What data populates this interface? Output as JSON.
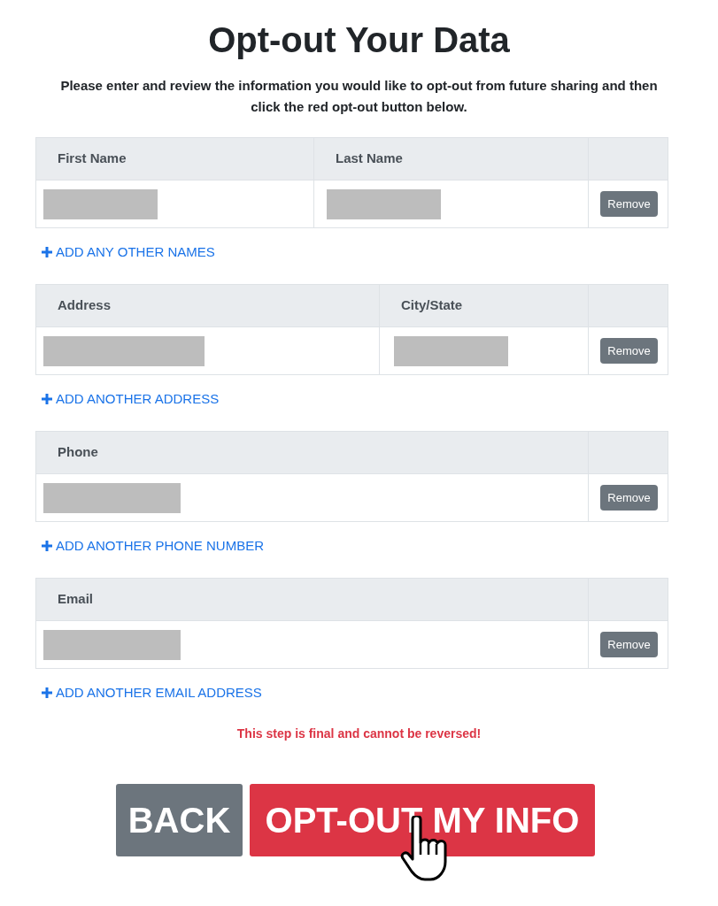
{
  "title": "Opt-out Your Data",
  "instructions": "Please enter and review the information you would like to opt-out from future sharing and then click the red opt-out button below.",
  "sections": [
    {
      "columns": [
        "First Name",
        "Last Name"
      ],
      "cells": [
        {
          "kind": "redacted"
        },
        {
          "kind": "redacted"
        }
      ],
      "remove_button": "Remove",
      "add_link": "ADD ANY OTHER NAMES"
    },
    {
      "columns": [
        "Address",
        "City/State"
      ],
      "cells": [
        {
          "kind": "redacted"
        },
        {
          "kind": "redacted"
        }
      ],
      "remove_button": "Remove",
      "add_link": "ADD ANOTHER ADDRESS"
    },
    {
      "columns": [
        "Phone"
      ],
      "cells": [
        {
          "kind": "redacted"
        }
      ],
      "remove_button": "Remove",
      "add_link": "ADD ANOTHER PHONE NUMBER"
    },
    {
      "columns": [
        "Email"
      ],
      "cells": [
        {
          "kind": "redacted"
        }
      ],
      "remove_button": "Remove",
      "add_link": "ADD ANOTHER EMAIL ADDRESS"
    }
  ],
  "warning": "This step is final and cannot be reversed!",
  "back_button": "BACK",
  "optout_button": "OPT-OUT MY INFO"
}
